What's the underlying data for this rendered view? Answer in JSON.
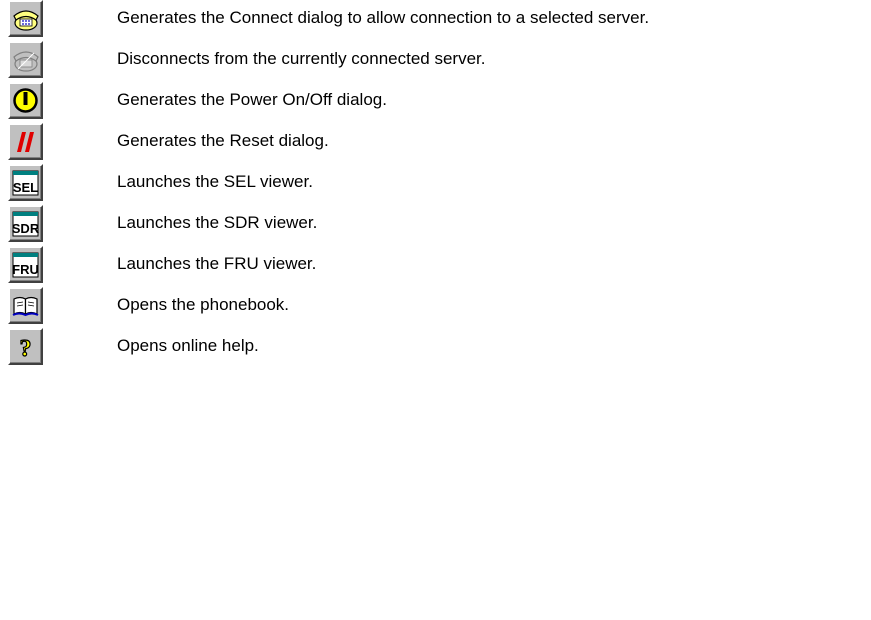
{
  "toolbar": {
    "buttons": [
      {
        "icon": "connect-phone-icon",
        "description": "Generates the Connect dialog to allow connection to a selected server."
      },
      {
        "icon": "disconnect-phone-icon",
        "description": "Disconnects from the currently connected server."
      },
      {
        "icon": "power-icon",
        "description": "Generates the Power On/Off dialog."
      },
      {
        "icon": "reset-icon",
        "description": "Generates the Reset dialog."
      },
      {
        "icon": "sel-viewer-icon",
        "label": "SEL",
        "description": "Launches the SEL viewer."
      },
      {
        "icon": "sdr-viewer-icon",
        "label": "SDR",
        "description": "Launches the SDR viewer."
      },
      {
        "icon": "fru-viewer-icon",
        "label": "FRU",
        "description": "Launches the FRU viewer."
      },
      {
        "icon": "phonebook-icon",
        "description": "Opens the phonebook."
      },
      {
        "icon": "help-icon",
        "description": "Opens online help."
      }
    ]
  },
  "colors": {
    "button_face": "#c0c0c0",
    "phone_yellow": "#ffff80",
    "power_yellow": "#ffff00",
    "reset_red": "#e00000",
    "viewer_bar": "#008080",
    "phonebook_blue": "#0000c0"
  }
}
